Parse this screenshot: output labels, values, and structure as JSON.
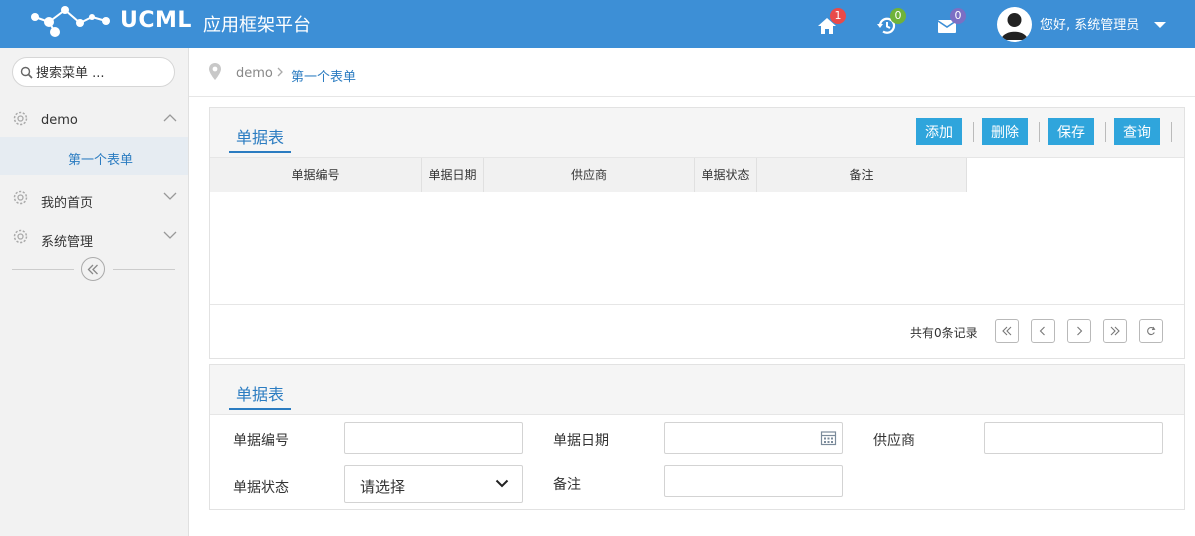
{
  "header": {
    "brand": "UCML",
    "brand_sub": "应用框架平台",
    "badges": {
      "home": "1",
      "history": "0",
      "messages": "0"
    },
    "user_greeting": "您好, 系统管理员",
    "colors": {
      "bar": "#3d8fd6",
      "badge_home": "#e94a4a",
      "badge_history": "#6fb33a",
      "badge_messages": "#7b6fc4"
    }
  },
  "sidebar": {
    "search_placeholder": "搜索菜单 ...",
    "menu": [
      {
        "label": "demo",
        "icon": "gear-icon",
        "expanded": true,
        "children": [
          "第一个表单"
        ]
      },
      {
        "label": "我的首页",
        "icon": "gear-icon",
        "expanded": false
      },
      {
        "label": "系统管理",
        "icon": "gear-icon",
        "expanded": false
      }
    ]
  },
  "breadcrumb": {
    "root": "demo",
    "current": "第一个表单"
  },
  "grid_panel": {
    "title": "单据表",
    "buttons": {
      "add": "添加",
      "delete": "删除",
      "save": "保存",
      "query": "查询"
    },
    "columns": [
      "单据编号",
      "单据日期",
      "供应商",
      "单据状态",
      "备注"
    ],
    "rows": [],
    "total_text": "共有0条记录"
  },
  "form_panel": {
    "title": "单据表",
    "fields": {
      "code": {
        "label": "单据编号",
        "value": ""
      },
      "date": {
        "label": "单据日期",
        "value": ""
      },
      "supplier": {
        "label": "供应商",
        "value": ""
      },
      "status": {
        "label": "单据状态",
        "selected": "请选择"
      },
      "remark": {
        "label": "备注",
        "value": ""
      }
    }
  },
  "accent_color": "#2b7cc1",
  "button_color": "#2fa5dc"
}
